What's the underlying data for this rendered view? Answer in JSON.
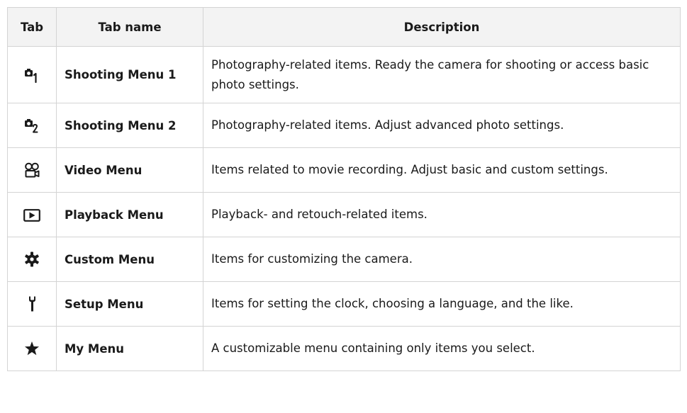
{
  "table": {
    "headers": {
      "tab": "Tab",
      "name": "Tab name",
      "description": "Description"
    },
    "rows": [
      {
        "icon": "camera-1-icon",
        "name": "Shooting Menu 1",
        "description": "Photography-related items. Ready the camera for shooting or access basic photo settings."
      },
      {
        "icon": "camera-2-icon",
        "name": "Shooting Menu 2",
        "description": "Photography-related items. Adjust advanced photo settings."
      },
      {
        "icon": "video-camera-icon",
        "name": "Video Menu",
        "description": "Items related to movie recording. Adjust basic and custom settings."
      },
      {
        "icon": "playback-icon",
        "name": "Playback Menu",
        "description": "Playback- and retouch-related items."
      },
      {
        "icon": "gear-icon",
        "name": "Custom Menu",
        "description": "Items for customizing the camera."
      },
      {
        "icon": "wrench-icon",
        "name": "Setup Menu",
        "description": "Items for setting the clock, choosing a language, and the like."
      },
      {
        "icon": "star-icon",
        "name": "My Menu",
        "description": "A customizable menu containing only items you select."
      }
    ]
  },
  "colors": {
    "header_bg": "#f3f3f3",
    "border": "#d4d4d4",
    "text": "#1a1a1a"
  }
}
